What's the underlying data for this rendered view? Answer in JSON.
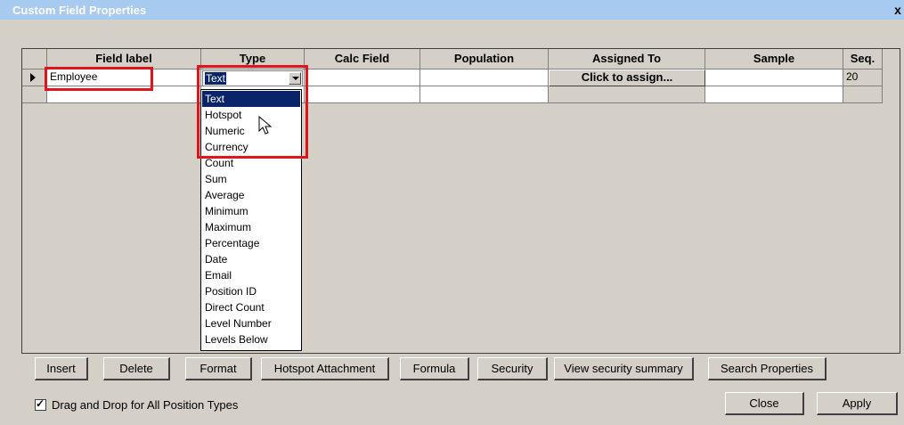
{
  "window": {
    "title": "Custom Field Properties",
    "close_label": "x"
  },
  "grid": {
    "columns": [
      "Field label",
      "Type",
      "Calc Field",
      "Population",
      "Assigned To",
      "Sample",
      "Seq."
    ],
    "rows": [
      {
        "field_label": "Employee",
        "type": "Text",
        "calc_field": "",
        "population": "",
        "assigned_to": "Click to assign...",
        "sample": "",
        "seq": "20"
      },
      {
        "field_label": "",
        "type": "",
        "calc_field": "",
        "population": "",
        "assigned_to": "",
        "sample": "",
        "seq": ""
      }
    ]
  },
  "type_dropdown": {
    "selected": "Text",
    "options": [
      "Text",
      "Hotspot",
      "Numeric",
      "Currency",
      "Count",
      "Sum",
      "Average",
      "Minimum",
      "Maximum",
      "Percentage",
      "Date",
      "Email",
      "Position ID",
      "Direct Count",
      "Level Number",
      "Levels Below"
    ]
  },
  "buttons": {
    "insert": "Insert",
    "delete": "Delete",
    "format": "Format",
    "hotspot_attachment": "Hotspot Attachment",
    "formula": "Formula",
    "security": "Security",
    "view_security_summary": "View security summary",
    "search_properties": "Search Properties",
    "close": "Close",
    "apply": "Apply"
  },
  "options": {
    "drag_drop_label": "Drag and Drop for All Position Types",
    "drag_drop_checked": true
  },
  "colors": {
    "highlight": "#e0141b",
    "selection": "#0a246a",
    "face": "#d4d0c8"
  }
}
